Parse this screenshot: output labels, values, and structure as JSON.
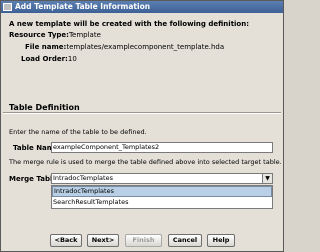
{
  "window": {
    "title": "Add Template Table Information"
  },
  "intro": "A new template will be created with the following definition:",
  "definition": {
    "resource_type_label": "Resource Type:",
    "resource_type_value": "Template",
    "file_name_label": "File name:",
    "file_name_value": "templates/examplecomponent_template.hda",
    "load_order_label": "Load Order:",
    "load_order_value": "10"
  },
  "section_title": "Table Definition",
  "table_instructions": "Enter the name of the table to be defined.",
  "table_name": {
    "label": "Table Name:",
    "value": "exampleComponent_Templates2"
  },
  "merge_instructions": "The merge rule is used to merge the table defined above into selected target table.",
  "merge_table": {
    "label": "Merge Table:",
    "selected": "IntradocTemplates",
    "options": [
      "IntradocTemplates",
      "SearchResultTemplates"
    ]
  },
  "buttons": {
    "back": "<Back",
    "next": "Next>",
    "finish": "Finish",
    "cancel": "Cancel",
    "help": "Help"
  }
}
